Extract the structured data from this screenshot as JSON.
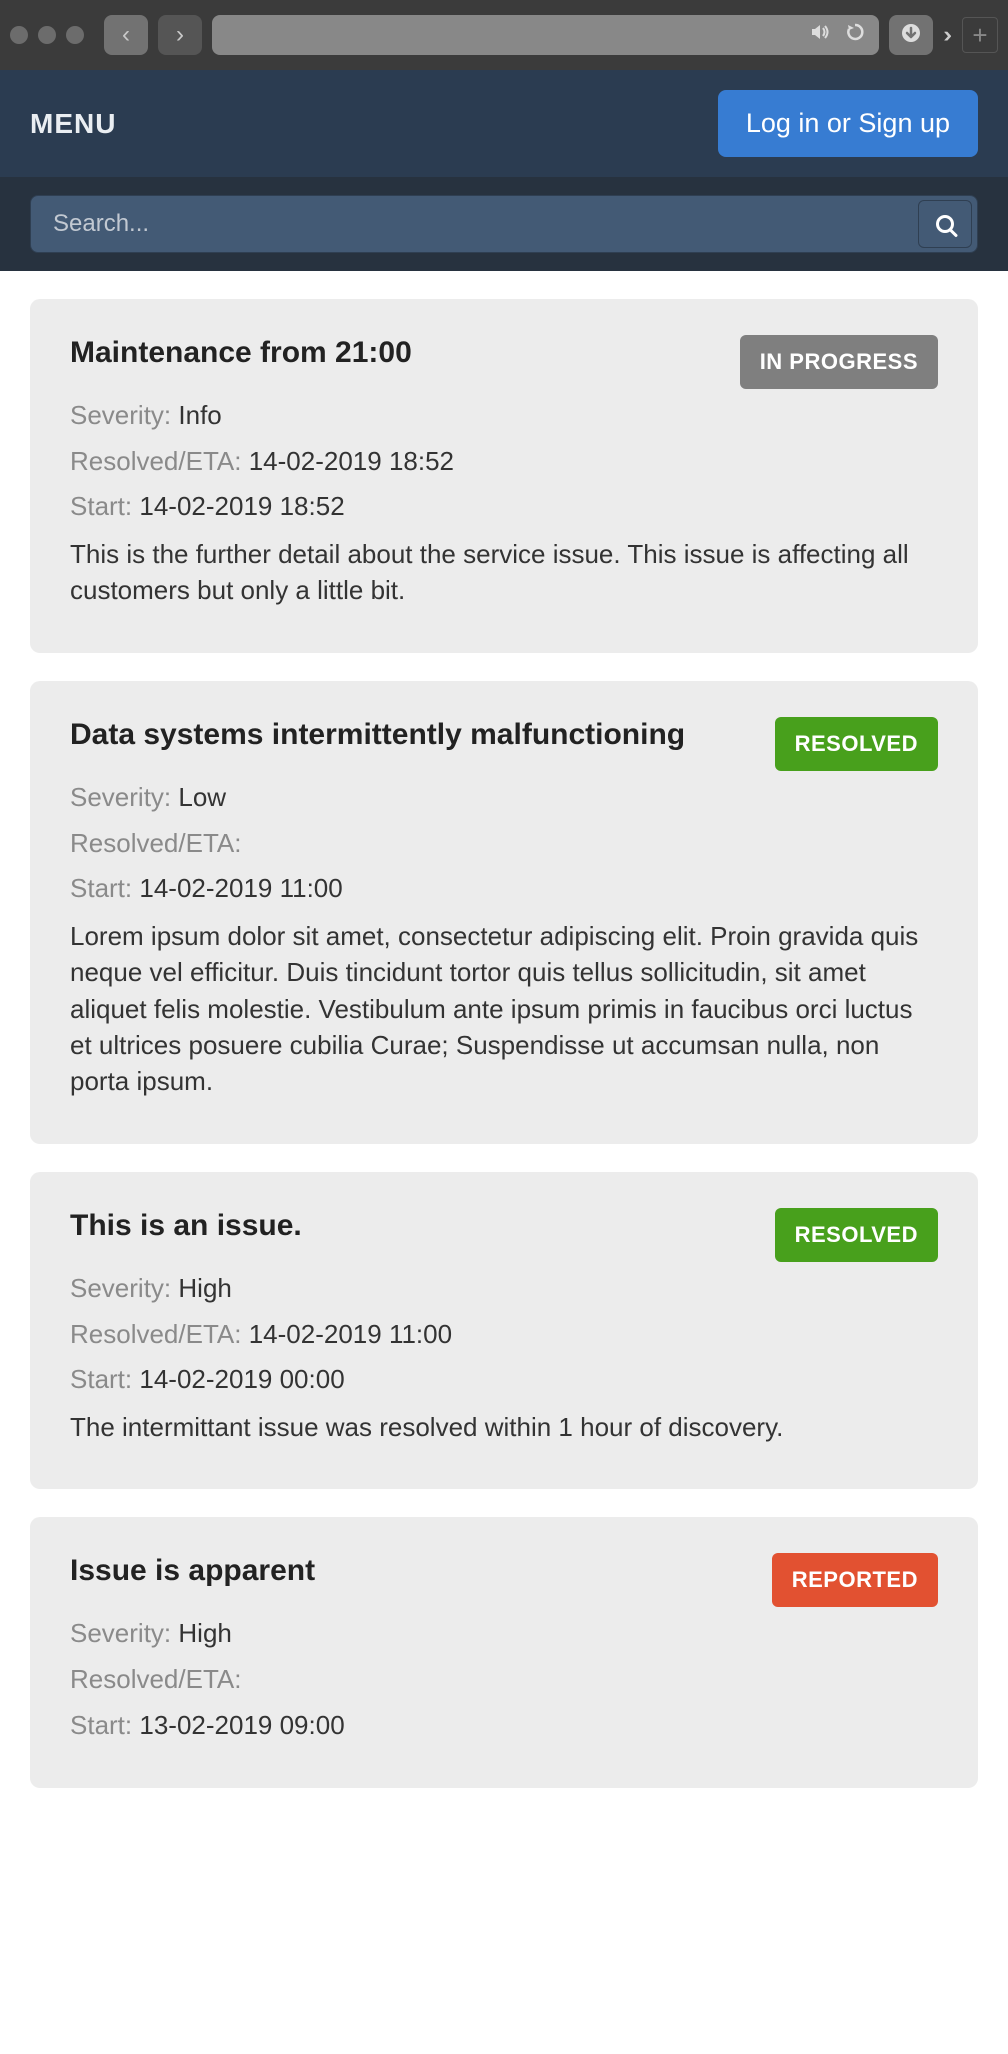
{
  "chrome": {
    "sound_icon": "sound-icon",
    "reload_icon": "reload-icon",
    "download_icon": "download-icon"
  },
  "header": {
    "menu_label": "MENU",
    "login_label": "Log in or Sign up"
  },
  "search": {
    "placeholder": "Search..."
  },
  "labels": {
    "severity": "Severity:",
    "resolved_eta": "Resolved/ETA:",
    "start": "Start:"
  },
  "status_text": {
    "in_progress": "IN PROGRESS",
    "resolved": "RESOLVED",
    "reported": "REPORTED"
  },
  "issues": [
    {
      "title": "Maintenance from 21:00",
      "status": "in_progress",
      "severity": "Info",
      "resolved_eta": "14-02-2019 18:52",
      "start": "14-02-2019 18:52",
      "description": "This is the further detail about the service issue. This issue is affecting all customers but only a little bit."
    },
    {
      "title": "Data systems intermittently malfunctioning",
      "status": "resolved",
      "severity": "Low",
      "resolved_eta": "",
      "start": "14-02-2019 11:00",
      "description": "Lorem ipsum dolor sit amet, consectetur adipiscing elit. Proin gravida quis neque vel efficitur. Duis tincidunt tortor quis tellus sollicitudin, sit amet aliquet felis molestie. Vestibulum ante ipsum primis in faucibus orci luctus et ultrices posuere cubilia Curae; Suspendisse ut accumsan nulla, non porta ipsum."
    },
    {
      "title": "This is an issue.",
      "status": "resolved",
      "severity": "High",
      "resolved_eta": "14-02-2019 11:00",
      "start": "14-02-2019 00:00",
      "description": "The intermittant issue was resolved within 1 hour of discovery."
    },
    {
      "title": "Issue is apparent",
      "status": "reported",
      "severity": "High",
      "resolved_eta": "",
      "start": "13-02-2019 09:00",
      "description": ""
    }
  ]
}
